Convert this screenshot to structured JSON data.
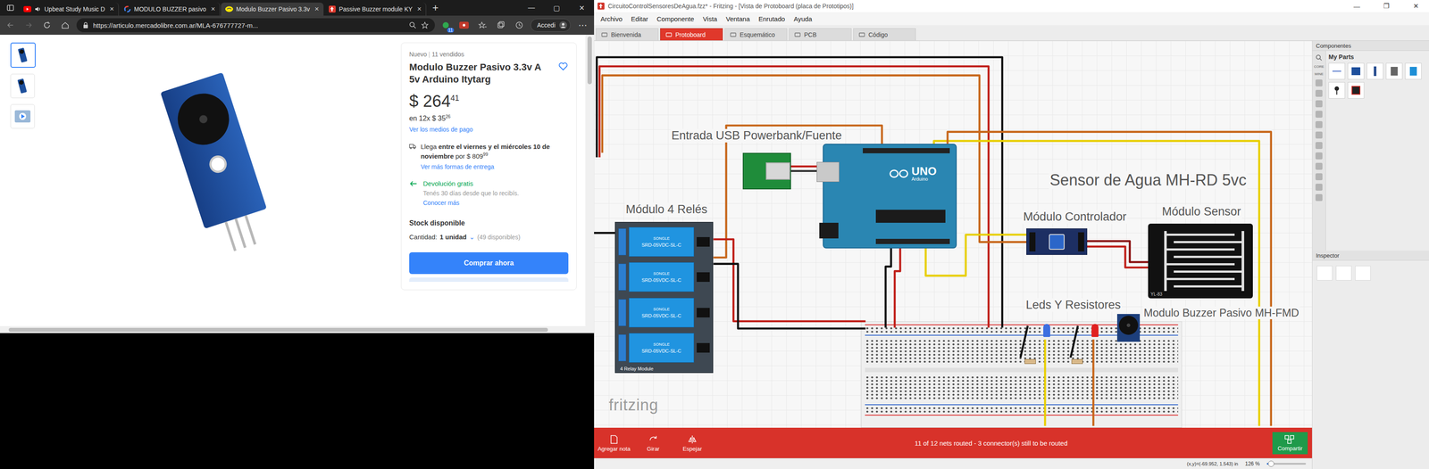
{
  "browser": {
    "tabs": [
      {
        "label": "Upbeat Study Music D",
        "selected": false,
        "favicon": "youtube",
        "audio": true
      },
      {
        "label": "MODULO BUZZER pasivo",
        "selected": false,
        "favicon": "google",
        "audio": false
      },
      {
        "label": "Modulo Buzzer Pasivo 3.3v",
        "selected": true,
        "favicon": "mercadolibre",
        "audio": false
      },
      {
        "label": "Passive Buzzer module KY",
        "selected": false,
        "favicon": "red",
        "audio": false
      }
    ],
    "tab_close": "×",
    "new_tab": "+",
    "window_controls": [
      "—",
      "▢",
      "✕"
    ],
    "url": "https://articulo.mercadolibre.com.ar/MLA-676777727-m...",
    "extension_badge": "11",
    "profile_button": "Accedi",
    "more": "⋯"
  },
  "product": {
    "thumbnails": [
      {
        "selected": true,
        "kind": "photo"
      },
      {
        "selected": false,
        "kind": "photo"
      },
      {
        "selected": false,
        "kind": "video"
      }
    ],
    "condition": "Nuevo",
    "separator": "|",
    "sold": "11 vendidos",
    "title": "Modulo Buzzer Pasivo 3.3v A 5v Arduino Itytarg",
    "favorite": false,
    "price": "$ 264",
    "price_cents": "41",
    "installments": "en 12x $ 35",
    "installments_cents": "26",
    "payment_link": "Ver los medios de pago",
    "delivery": {
      "prefix": "Llega",
      "bold": "entre el viernes y el miércoles 10 de noviembre",
      "price": "por $ 809",
      "cents": "99",
      "link": "Ver más formas de entrega"
    },
    "returns": {
      "title": "Devolución gratis",
      "detail": "Tenés 30 días desde que lo recibís.",
      "link": "Conocer más"
    },
    "stock": "Stock disponible",
    "quantity": {
      "label": "Cantidad:",
      "value": "1 unidad",
      "caret": "⌄",
      "available": "(49 disponibles)"
    },
    "buy_button": "Comprar ahora"
  },
  "fritzing": {
    "title": "CircuitoControlSensoresDeAgua.fzz* - Fritzing - [Vista de Protoboard (placa de Prototipos)]",
    "window_controls": [
      "—",
      "❐",
      "✕"
    ],
    "menu": [
      "Archivo",
      "Editar",
      "Componente",
      "Vista",
      "Ventana",
      "Enrutado",
      "Ayuda"
    ],
    "tabs": [
      {
        "label": "Bienvenida",
        "selected": false
      },
      {
        "label": "Protoboard",
        "selected": true
      },
      {
        "label": "Esquemático",
        "selected": false
      },
      {
        "label": "PCB",
        "selected": false
      },
      {
        "label": "Código",
        "selected": false
      }
    ],
    "canvas": {
      "labels": {
        "usb": "Entrada USB Powerbank/Fuente",
        "relay": "Módulo 4 Relés",
        "sensor_title": "Sensor de Agua MH-RD 5vc",
        "controller": "Módulo Controlador",
        "sensor": "Módulo Sensor",
        "leds": "Leds Y Resistores",
        "buzzer": "Modulo Buzzer Pasivo MH-FMD"
      },
      "watermark": "fritzing",
      "arduino": {
        "model": "UNO",
        "brand": "Arduino"
      },
      "relay_module": {
        "relays": [
          {
            "brand": "SONGLE",
            "model": "SRD-05VDC-SL-C"
          },
          {
            "brand": "SONGLE",
            "model": "SRD-05VDC-SL-C"
          },
          {
            "brand": "SONGLE",
            "model": "SRD-05VDC-SL-C"
          },
          {
            "brand": "SONGLE",
            "model": "SRD-05VDC-SL-C"
          }
        ],
        "caption": "4 Relay Module"
      },
      "sensor_part": "YL-83",
      "leds": [
        {
          "color": "#3d6fe0"
        },
        {
          "color": "#e02020"
        }
      ]
    },
    "toolbar": [
      {
        "label": "Agregar nota",
        "icon": "note"
      },
      {
        "label": "Girar",
        "icon": "rotate"
      },
      {
        "label": "Espejar",
        "icon": "flip"
      }
    ],
    "routing_status": "11 of 12 nets routed - 3 connector(s) still to be routed",
    "share_button": "Compartir",
    "coordinates": "(x,y)=(-69.952, 1.543) in",
    "zoom": "126 %",
    "zoom_slider": {
      "level": 0.1
    },
    "parts_panel": {
      "title": "Componentes",
      "bins": [
        "CORE",
        "MINE"
      ],
      "section": "My Parts",
      "parts": [
        {
          "kind": "wire"
        },
        {
          "kind": "board"
        },
        {
          "kind": "strip"
        },
        {
          "kind": "module"
        },
        {
          "kind": "sensor"
        },
        {
          "kind": "pin"
        },
        {
          "kind": "chip"
        }
      ]
    },
    "inspector": {
      "title": "Inspector"
    }
  }
}
